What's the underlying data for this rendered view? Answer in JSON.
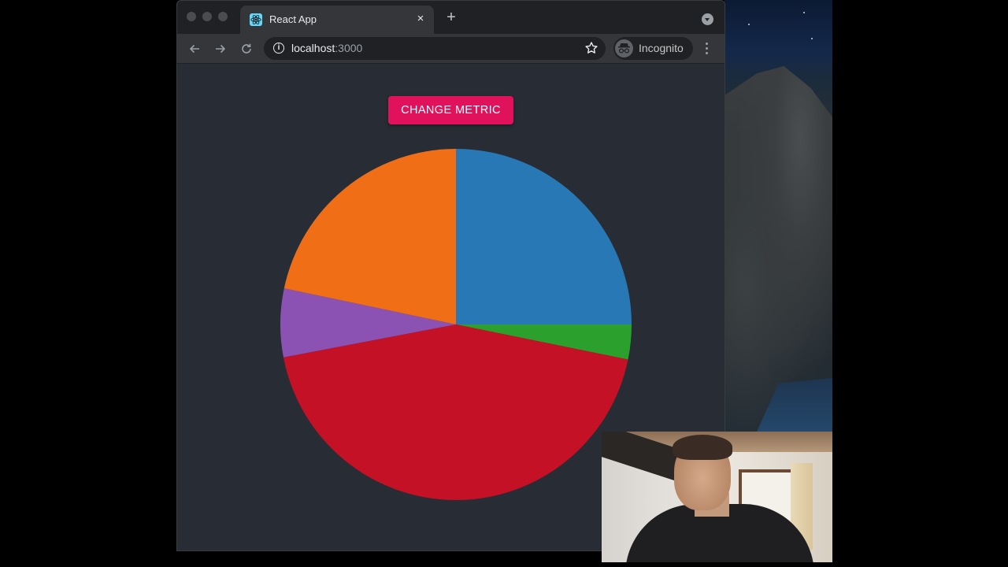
{
  "browser": {
    "tab_title": "React App",
    "tab_close_glyph": "×",
    "new_tab_glyph": "+",
    "url_host": "localhost",
    "url_port": ":3000",
    "incognito_label": "Incognito",
    "icons": {
      "back": "arrow-left-icon",
      "forward": "arrow-right-icon",
      "reload": "reload-icon",
      "info": "info-icon",
      "bookmark": "star-icon",
      "incognito": "incognito-icon",
      "menu": "kebab-menu-icon",
      "tab_search": "chevron-down-icon",
      "favicon": "react-logo-icon"
    }
  },
  "app": {
    "button_label": "CHANGE METRIC",
    "button_color": "#e0125c",
    "background": "#282c34"
  },
  "chart_data": {
    "type": "pie",
    "title": "",
    "start": "12 o'clock, clockwise",
    "slices": [
      {
        "value": 25.0,
        "color": "#2878b5"
      },
      {
        "value": 3.2,
        "color": "#2ca02c"
      },
      {
        "value": 43.8,
        "color": "#c41126"
      },
      {
        "value": 6.3,
        "color": "#8c52b3"
      },
      {
        "value": 21.7,
        "color": "#f06e15"
      }
    ]
  },
  "overlay": {
    "webcam": "presenter-webcam"
  }
}
